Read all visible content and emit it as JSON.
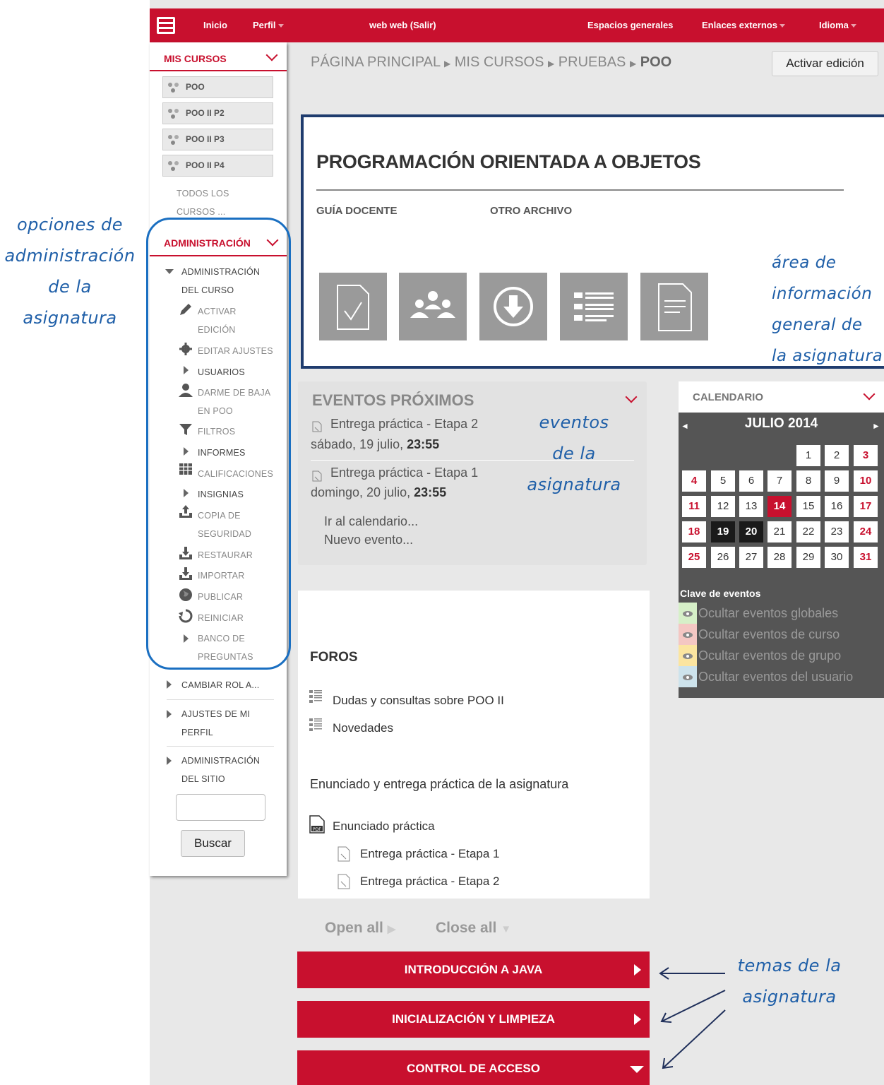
{
  "topbar": {
    "inicio": "Inicio",
    "perfil": "Perfil",
    "user": "web web (Salir)",
    "espacios": "Espacios generales",
    "enlaces": "Enlaces externos",
    "idioma": "Idioma"
  },
  "sidebar": {
    "mis_cursos": "MIS CURSOS",
    "courses": [
      "POO",
      "POO II P2",
      "POO II P3",
      "POO II P4"
    ],
    "todos": [
      "TODOS LOS",
      "CURSOS ..."
    ],
    "administracion": "ADMINISTRACIÓN",
    "admin_curso": [
      "ADMINISTRACIÓN",
      "DEL CURSO"
    ],
    "items": {
      "activar": [
        "ACTIVAR",
        "EDICIÓN"
      ],
      "editar": "EDITAR AJUSTES",
      "usuarios": "USUARIOS",
      "baja": [
        "DARME DE BAJA",
        "EN POO"
      ],
      "filtros": "FILTROS",
      "informes": "INFORMES",
      "calificaciones": "CALIFICACIONES",
      "insignias": "INSIGNIAS",
      "copia": [
        "COPIA DE",
        "SEGURIDAD"
      ],
      "restaurar": "RESTAURAR",
      "importar": "IMPORTAR",
      "publicar": "PUBLICAR",
      "reiniciar": "REINICIAR",
      "banco": [
        "BANCO DE",
        "PREGUNTAS"
      ]
    },
    "cambiar_rol": "CAMBIAR ROL A...",
    "ajustes_perfil": [
      "AJUSTES DE MI",
      "PERFIL"
    ],
    "admin_sitio": [
      "ADMINISTRACIÓN",
      "DEL SITIO"
    ],
    "search_value": "",
    "buscar": "Buscar"
  },
  "breadcrumb": {
    "items": [
      "PÁGINA PRINCIPAL",
      "MIS CURSOS",
      "PRUEBAS"
    ],
    "current": "POO"
  },
  "activar_edicion": "Activar edición",
  "course_info": {
    "title": "PROGRAMACIÓN ORIENTADA A OBJETOS",
    "link1": "GUÍA DOCENTE",
    "link2": "OTRO ARCHIVO",
    "icons": [
      "assignment-icon",
      "users-icon",
      "download-icon",
      "list-icon",
      "document-icon"
    ]
  },
  "events": {
    "title": "EVENTOS PRÓXIMOS",
    "e1_name": "Entrega práctica - Etapa 2",
    "e1_date": "sábado, 19 julio, ",
    "e1_time": "23:55",
    "e2_name": "Entrega práctica - Etapa 1",
    "e2_date": "domingo, 20 julio, ",
    "e2_time": "23:55",
    "ir": "Ir al calendario...",
    "nuevo": "Nuevo evento..."
  },
  "calendar": {
    "title": "CALENDARIO",
    "month": "JULIO 2014",
    "days": [
      "1",
      "2",
      "3",
      "4",
      "5",
      "6",
      "7",
      "8",
      "9",
      "10",
      "11",
      "12",
      "13",
      "14",
      "15",
      "16",
      "17",
      "18",
      "19",
      "20",
      "21",
      "22",
      "23",
      "24",
      "25",
      "26",
      "27",
      "28",
      "29",
      "30",
      "31"
    ],
    "clave": "Clave de eventos",
    "keys": [
      "Ocultar eventos globales",
      "Ocultar eventos de curso",
      "Ocultar eventos de grupo",
      "Ocultar eventos del usuario"
    ],
    "key_colors": [
      "#d6f0c8",
      "#f4c7c3",
      "#fbe5a0",
      "#cde3ec"
    ]
  },
  "forums": {
    "title": "FOROS",
    "f1": "Dudas y consultas sobre POO II",
    "f2": "Novedades",
    "section": "Enunciado y entrega práctica de la asignatura",
    "pdf": "Enunciado práctica",
    "a1": "Entrega práctica - Etapa 1",
    "a2": "Entrega práctica - Etapa 2"
  },
  "open_all": "Open all",
  "close_all": "Close all",
  "topics": [
    "INTRODUCCIÓN A JAVA",
    "INICIALIZACIÓN Y LIMPIEZA",
    "CONTROL DE ACCESO"
  ],
  "annotations": {
    "admin": [
      "opciones de",
      "administración",
      "de la",
      "asignatura"
    ],
    "info": [
      "área de",
      "información",
      "general de",
      "la asignatura"
    ],
    "events": [
      "eventos",
      "de la",
      "asignatura"
    ],
    "topics": [
      "temas de la",
      "asignatura"
    ]
  },
  "colors": {
    "brand": "#c8102e",
    "annotation": "#1f5fa8"
  }
}
